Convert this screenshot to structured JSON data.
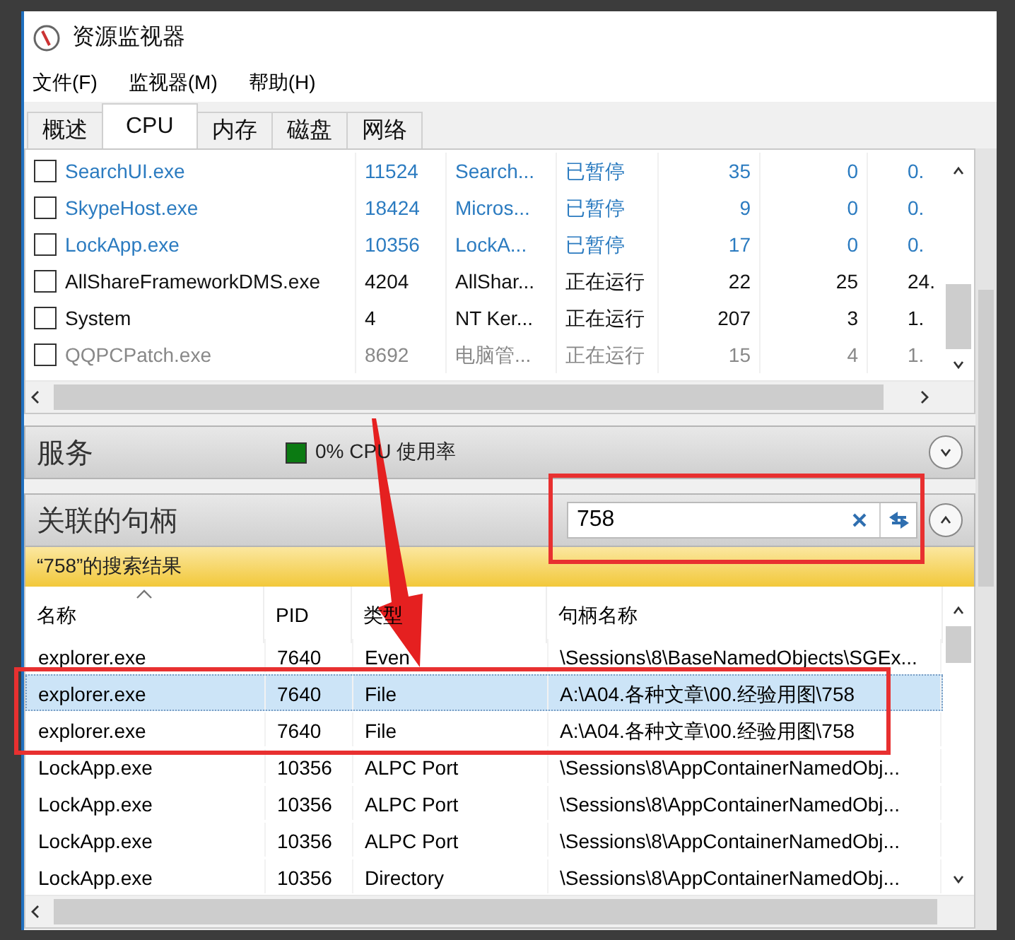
{
  "window": {
    "title": "资源监视器"
  },
  "menu": [
    "文件(F)",
    "监视器(M)",
    "帮助(H)"
  ],
  "tabs": [
    {
      "label": "概述",
      "selected": false
    },
    {
      "label": "CPU",
      "selected": true
    },
    {
      "label": "内存",
      "selected": false
    },
    {
      "label": "磁盘",
      "selected": false
    },
    {
      "label": "网络",
      "selected": false
    }
  ],
  "processes": {
    "rows": [
      {
        "kind": "suspended",
        "checked": false,
        "name": "SearchUI.exe",
        "pid": "11524",
        "description": "Search...",
        "status": "已暂停",
        "threads": "35",
        "cpu": "0",
        "column_7": "0."
      },
      {
        "kind": "suspended",
        "checked": false,
        "name": "SkypeHost.exe",
        "pid": "18424",
        "description": "Micros...",
        "status": "已暂停",
        "threads": "9",
        "cpu": "0",
        "column_7": "0."
      },
      {
        "kind": "suspended",
        "checked": false,
        "name": "LockApp.exe",
        "pid": "10356",
        "description": "LockA...",
        "status": "已暂停",
        "threads": "17",
        "cpu": "0",
        "column_7": "0."
      },
      {
        "kind": "running",
        "checked": false,
        "name": "AllShareFrameworkDMS.exe",
        "pid": "4204",
        "description": "AllShar...",
        "status": "正在运行",
        "threads": "22",
        "cpu": "25",
        "column_7": "24."
      },
      {
        "kind": "running",
        "checked": false,
        "name": "System",
        "pid": "4",
        "description": "NT Ker...",
        "status": "正在运行",
        "threads": "207",
        "cpu": "3",
        "column_7": "1."
      },
      {
        "kind": "ended",
        "checked": false,
        "name": "QQPCPatch.exe",
        "pid": "8692",
        "description": "电脑管...",
        "status": "正在运行",
        "threads": "15",
        "cpu": "4",
        "column_7": "1."
      }
    ]
  },
  "services": {
    "title": "服务",
    "cpu_usage": "0% CPU 使用率",
    "expanded": false
  },
  "handles": {
    "title": "关联的句柄",
    "expanded": true,
    "search": {
      "value": "758"
    },
    "result_banner": "“758”的搜索结果",
    "columns": [
      "名称",
      "PID",
      "类型",
      "句柄名称"
    ],
    "rows": [
      {
        "name": "explorer.exe",
        "pid": "7640",
        "type": "Even",
        "handle_name": "\\Sessions\\8\\BaseNamedObjects\\SGEx...",
        "selected": false
      },
      {
        "name": "explorer.exe",
        "pid": "7640",
        "type": "File",
        "handle_name": "A:\\A04.各种文章\\00.经验用图\\758",
        "selected": true
      },
      {
        "name": "explorer.exe",
        "pid": "7640",
        "type": "File",
        "handle_name": "A:\\A04.各种文章\\00.经验用图\\758",
        "selected": false
      },
      {
        "name": "LockApp.exe",
        "pid": "10356",
        "type": "ALPC Port",
        "handle_name": "\\Sessions\\8\\AppContainerNamedObj...",
        "selected": false
      },
      {
        "name": "LockApp.exe",
        "pid": "10356",
        "type": "ALPC Port",
        "handle_name": "\\Sessions\\8\\AppContainerNamedObj...",
        "selected": false
      },
      {
        "name": "LockApp.exe",
        "pid": "10356",
        "type": "ALPC Port",
        "handle_name": "\\Sessions\\8\\AppContainerNamedObj...",
        "selected": false
      },
      {
        "name": "LockApp.exe",
        "pid": "10356",
        "type": "Directory",
        "handle_name": "\\Sessions\\8\\AppContainerNamedObj...",
        "selected": false
      }
    ]
  }
}
